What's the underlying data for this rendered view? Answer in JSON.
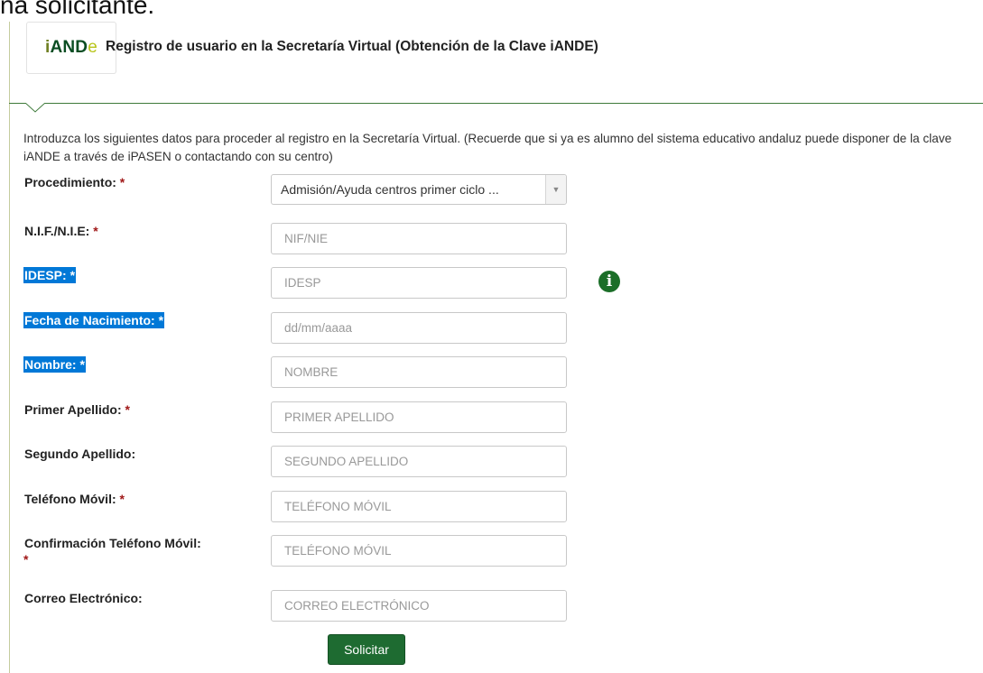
{
  "top_fragment": "na solicitante.",
  "header": {
    "logo": {
      "i": "i",
      "and": "AND",
      "e": "e"
    },
    "title": "Registro de usuario en la Secretaría Virtual (Obtención de la Clave iANDE)"
  },
  "intro": "Introduzca los siguientes datos para proceder al registro en la Secretaría Virtual. (Recuerde que si ya es alumno del sistema educativo andaluz puede disponer de la clave iANDE a través de iPASEN o contactando con su centro)",
  "required_mark": "*",
  "form": {
    "procedimiento": {
      "label": "Procedimiento:",
      "value": "Admisión/Ayuda centros primer ciclo ..."
    },
    "nif": {
      "label": "N.I.F./N.I.E:",
      "placeholder": "NIF/NIE"
    },
    "idesp": {
      "label": "IDESP:",
      "placeholder": "IDESP"
    },
    "fecha": {
      "label": "Fecha de Nacimiento:",
      "placeholder": "dd/mm/aaaa"
    },
    "nombre": {
      "label": "Nombre:",
      "placeholder": "NOMBRE"
    },
    "apellido1": {
      "label": "Primer Apellido:",
      "placeholder": "PRIMER APELLIDO"
    },
    "apellido2": {
      "label": "Segundo Apellido:",
      "placeholder": "SEGUNDO APELLIDO"
    },
    "movil": {
      "label": "Teléfono Móvil:",
      "placeholder": "TELÉFONO MÓVIL"
    },
    "movil_conf": {
      "label": "Confirmación Teléfono Móvil:",
      "placeholder": "TELÉFONO MÓVIL"
    },
    "correo": {
      "label": "Correo Electrónico:",
      "placeholder": "CORREO ELECTRÓNICO"
    }
  },
  "submit_label": "Solicitar",
  "colors": {
    "brand_green": "#1e6b31",
    "selection_blue": "#0078d7",
    "required_red": "#a01818"
  }
}
